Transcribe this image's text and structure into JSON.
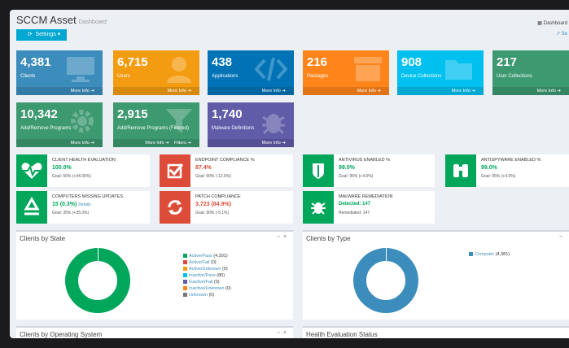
{
  "header": {
    "title": "SCCM Asset",
    "subtitle": "Dashboard",
    "settings_label": "Settings",
    "crumb": "Dashboard",
    "crumb2": "Se"
  },
  "tiles": [
    {
      "num": "4,381",
      "label": "Clients",
      "foot": "More Info",
      "color": "#3c8dbc"
    },
    {
      "num": "6,715",
      "label": "Users",
      "foot": "More Info",
      "color": "#f39c12"
    },
    {
      "num": "438",
      "label": "Applications",
      "foot": "More Info",
      "color": "#0073b7"
    },
    {
      "num": "216",
      "label": "Packages",
      "foot": "More Info",
      "color": "#ff851b"
    },
    {
      "num": "908",
      "label": "Device Collections",
      "foot": "More Info",
      "color": "#00c0ef"
    },
    {
      "num": "217",
      "label": "User Collections",
      "foot": "More Info",
      "color": "#3d9970"
    },
    {
      "num": "10,342",
      "label": "Add/Remove Programs",
      "foot": "More Info",
      "color": "#3d9970"
    },
    {
      "num": "2,915",
      "label": "Add/Remove Programs (Filtered)",
      "foot": "More Info",
      "foot2": "Filters",
      "color": "#3d9970"
    },
    {
      "num": "1,740",
      "label": "Malware Definitions",
      "foot": "More Info",
      "color": "#605ca8"
    }
  ],
  "info_boxes": [
    {
      "title": "CLIENT HEALTH EVALUATION",
      "value": "100.0%",
      "goal": "Goal: 56% (+44.00%)",
      "color": "#00a65a",
      "vcolor": "#00a65a"
    },
    {
      "title": "ENDPOINT COMPLIANCE %",
      "value": "87.4%",
      "goal": "Goal: 90% (-12.6%)",
      "color": "#dd4b39",
      "vcolor": "#dd4b39"
    },
    {
      "title": "ANTIVIRUS ENABLED %",
      "value": "99.0%",
      "goal": "Goal: 95% (+4.0%)",
      "color": "#00a65a",
      "vcolor": "#00a65a"
    },
    {
      "title": "ANTISPYWARE ENABLED %",
      "value": "99.0%",
      "goal": "Goal: 95% (+4.0%)",
      "color": "#00a65a",
      "vcolor": "#00a65a"
    },
    {
      "title": "COMPUTERS MISSING UPDATES",
      "value": "15 (0.3%)",
      "value_note": "Details",
      "goal": "Goal: 35% (+35.0%)",
      "color": "#00a65a",
      "vcolor": "#00a65a"
    },
    {
      "title": "PATCH COMPLIANCE",
      "value": "3,723 (84.9%)",
      "goal": "Goal: 90% (-5.1%)",
      "color": "#dd4b39",
      "vcolor": "#dd4b39"
    },
    {
      "title": "MALWARE REMEDIATION",
      "value": "Detected: 147",
      "goal": "Remediated: 147",
      "color": "#00a65a",
      "vcolor": "#00a65a"
    }
  ],
  "panels": {
    "clients_by_state": {
      "title": "Clients by State",
      "legend": [
        {
          "label": "Active/Pass",
          "count": "(4,301)",
          "color": "#00a65a"
        },
        {
          "label": "Active/Fail",
          "count": "(0)",
          "color": "#dd4b39"
        },
        {
          "label": "Active/Unknown",
          "count": "(0)",
          "color": "#f39c12"
        },
        {
          "label": "Inactive/Pass",
          "count": "(80)",
          "color": "#00c0ef"
        },
        {
          "label": "Inactive/Fail",
          "count": "(0)",
          "color": "#605ca8"
        },
        {
          "label": "Inactive/Unknown",
          "count": "(0)",
          "color": "#ff851b"
        },
        {
          "label": "Unknown",
          "count": "(0)",
          "color": "#777777"
        }
      ]
    },
    "clients_by_type": {
      "title": "Clients by Type",
      "legend": [
        {
          "label": "Computer",
          "count": "(4,381)",
          "color": "#3c8dbc"
        }
      ]
    },
    "clients_by_os": {
      "title": "Clients by Operating System"
    },
    "health_eval": {
      "title": "Health Evaluation Status"
    }
  },
  "icons": {
    "close": "×",
    "minus": "−"
  }
}
